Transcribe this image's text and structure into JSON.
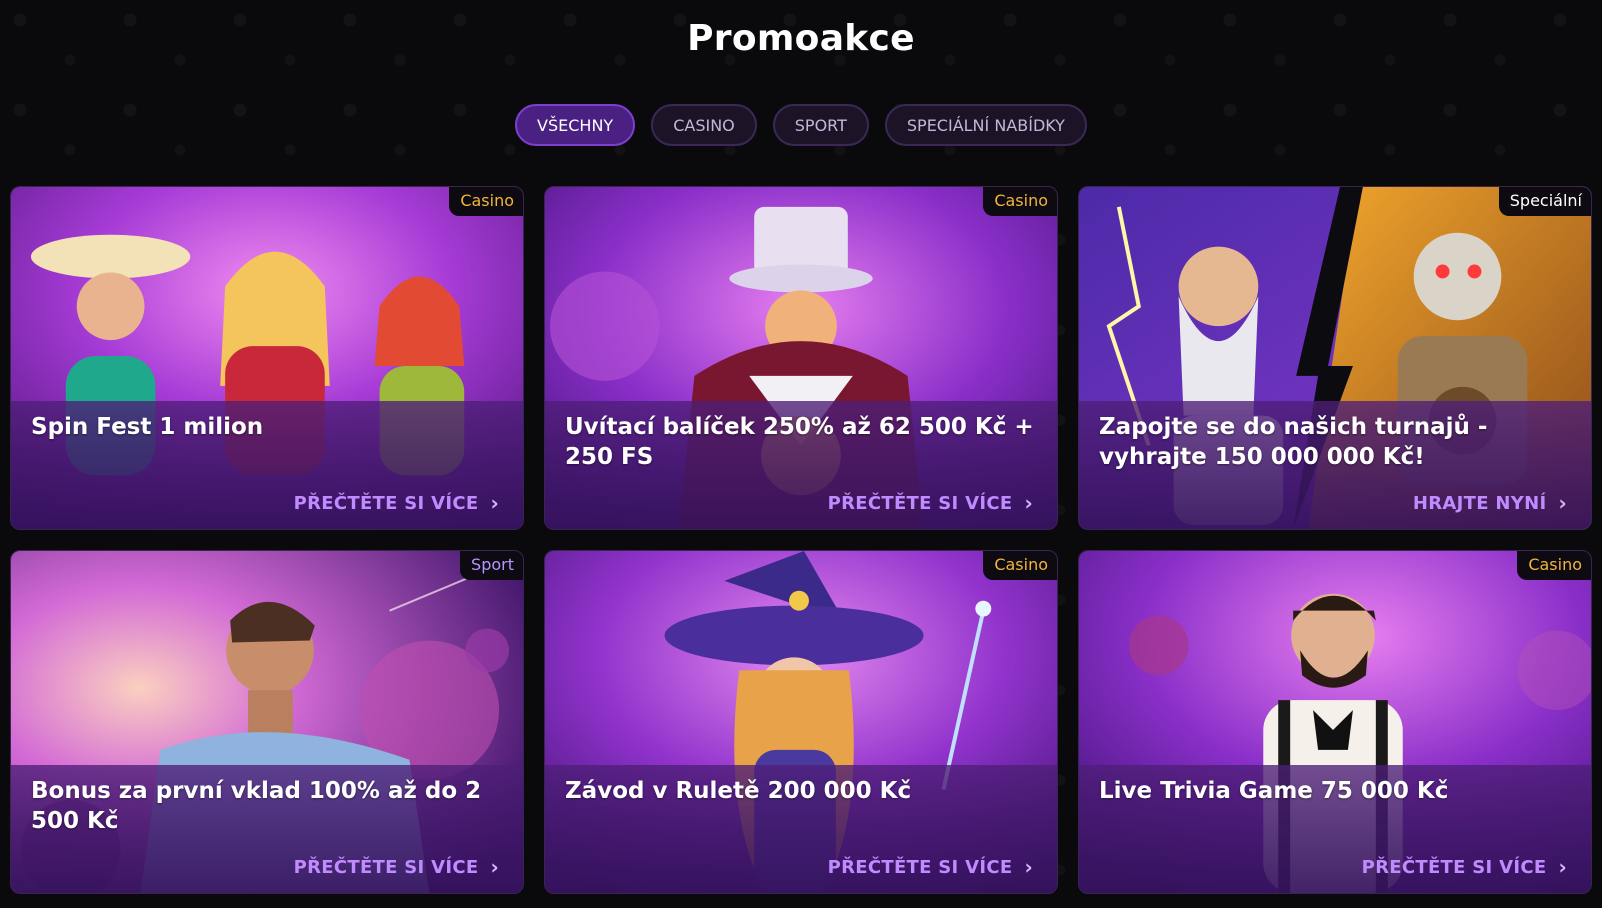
{
  "page": {
    "title": "Promoakce"
  },
  "filters": [
    {
      "label": "VŠECHNY",
      "active": true
    },
    {
      "label": "CASINO",
      "active": false
    },
    {
      "label": "SPORT",
      "active": false
    },
    {
      "label": "SPECIÁLNÍ NABÍDKY",
      "active": false
    }
  ],
  "promos": [
    {
      "badge": "Casino",
      "title": "Spin Fest 1 milion",
      "cta": "PŘEČTĚTE SI VÍCE",
      "chevron": "›",
      "image": "three-women-cocktails"
    },
    {
      "badge": "Casino",
      "title": "Uvítací balíček 250% až 62 500 Kč + 250 FS",
      "cta": "PŘEČTĚTE SI VÍCE",
      "chevron": "›",
      "image": "top-hat-magician"
    },
    {
      "badge": "Speciální",
      "title": "Zapojte se do našich turnajů - vyhrajte 150 000 000 Kč!",
      "cta": "HRAJTE NYNÍ",
      "chevron": "›",
      "image": "zeus-vs-skeleton"
    },
    {
      "badge": "Sport",
      "title": "Bonus za první vklad 100% až do 2 500 Kč",
      "cta": "PŘEČTĚTE SI VÍCE",
      "chevron": "›",
      "image": "football-player-space"
    },
    {
      "badge": "Casino",
      "title": "Závod v Ruletě 200 000 Kč",
      "cta": "PŘEČTĚTE SI VÍCE",
      "chevron": "›",
      "image": "witch-with-wand"
    },
    {
      "badge": "Casino",
      "title": "Live Trivia Game 75 000 Kč",
      "cta": "PŘEČTĚTE SI VÍCE",
      "chevron": "›",
      "image": "dealer-with-cards"
    }
  ],
  "colors": {
    "accent": "#7c3fd0",
    "badge_casino": "#f2b53a",
    "cta": "#c08bff",
    "background": "#0a0a0d"
  }
}
